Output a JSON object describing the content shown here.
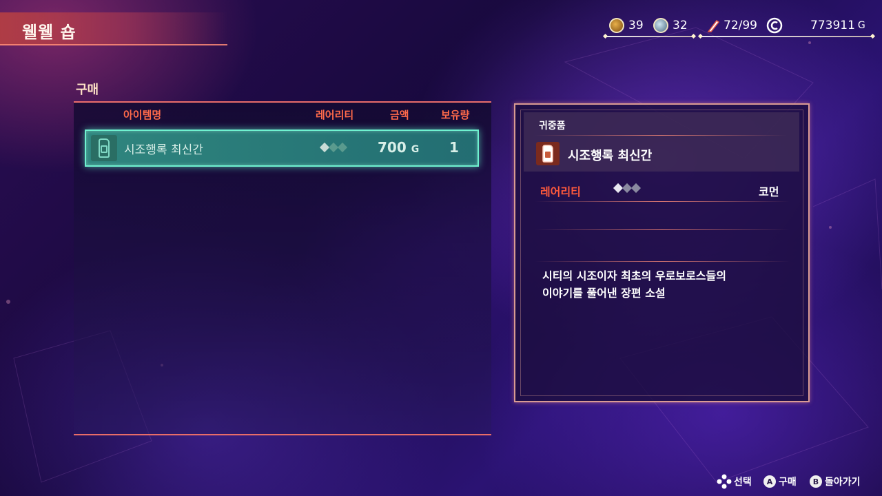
{
  "header": {
    "title": "웰웰 숍"
  },
  "status": {
    "sepith_a": "39",
    "sepith_b": "32",
    "capacity": "72/99",
    "money": "773911",
    "money_unit": "G",
    "icons": [
      "orange-sepith-icon",
      "blue-sepith-icon",
      "quill-icon",
      "coin-icon"
    ]
  },
  "section": {
    "label": "구매"
  },
  "list": {
    "columns": {
      "name": "아이템명",
      "rarity": "레어리티",
      "price": "금액",
      "owned": "보유량"
    },
    "items": [
      {
        "name": "시조행록 최신간",
        "rarity_level": 1,
        "rarity_max": 3,
        "price": "700",
        "price_unit": "G",
        "owned": "1",
        "icon": "book-item-icon"
      }
    ]
  },
  "detail": {
    "category": "귀중품",
    "name": "시조행록 최신간",
    "rarity_label": "레어리티",
    "rarity_value": "코먼",
    "rarity_level": 1,
    "rarity_max": 3,
    "description_lines": [
      "시티의 시조이자 최초의 우로보로스들의",
      "이야기를 풀어낸 장편 소설"
    ]
  },
  "footer": {
    "select": "선택",
    "buy_button": "A",
    "buy": "구매",
    "back_button": "B",
    "back": "돌아가기"
  },
  "colors": {
    "accent_red": "#ff5a3c",
    "highlight_teal": "#6ff2d0",
    "panel_border": "#ff7a6e"
  }
}
